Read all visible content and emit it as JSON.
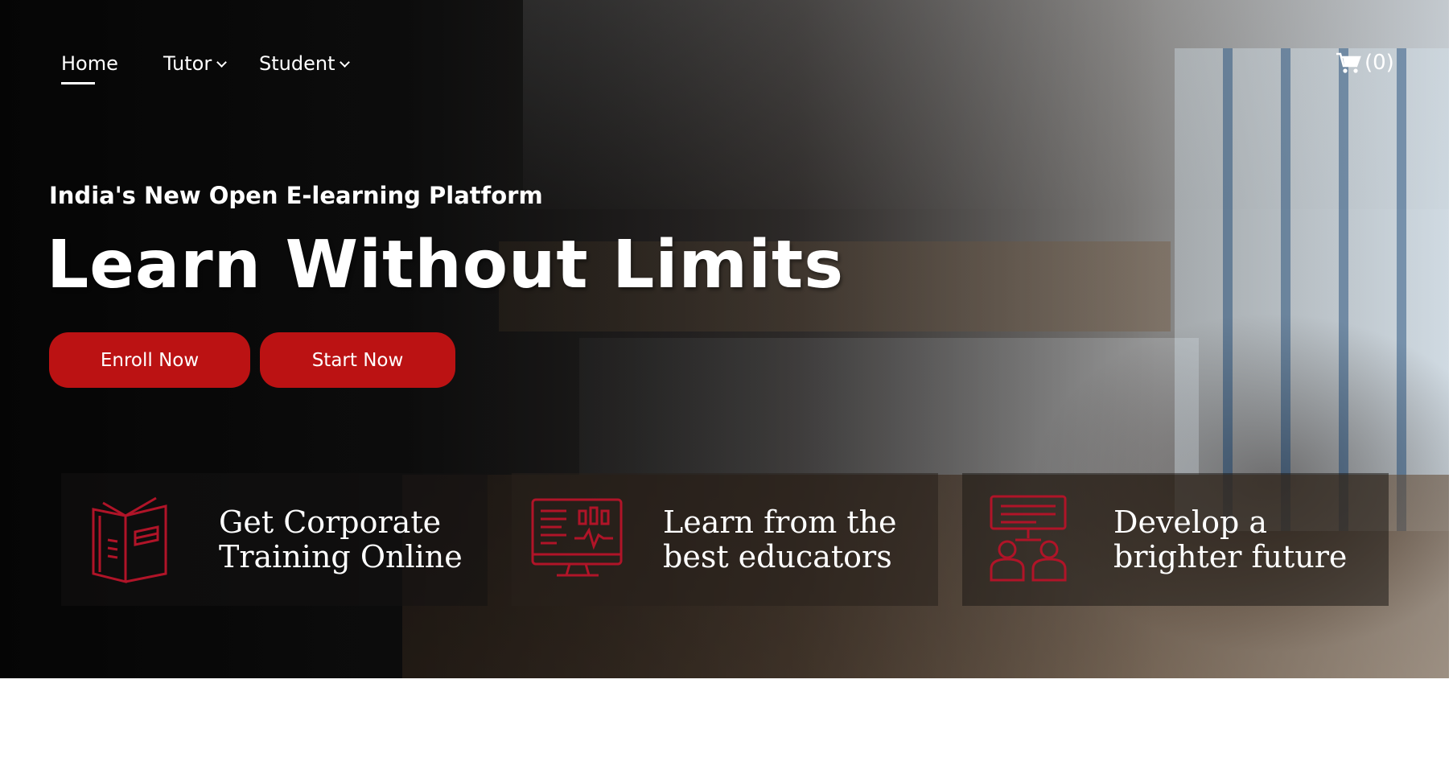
{
  "nav": {
    "home": "Home",
    "tutor": "Tutor",
    "student": "Student",
    "cart_count": "(0)"
  },
  "hero": {
    "tagline": "India's New Open E-learning Platform",
    "headline": "Learn Without Limits",
    "enroll_label": "Enroll Now",
    "start_label": "Start Now"
  },
  "features": [
    {
      "icon": "book-icon",
      "line1": "Get Corporate",
      "line2": "Training Online"
    },
    {
      "icon": "monitor-chart-icon",
      "line1": "Learn from the",
      "line2": "best educators"
    },
    {
      "icon": "presentation-people-icon",
      "line1": "Develop a",
      "line2": "brighter future"
    }
  ],
  "colors": {
    "accent": "#bb1213",
    "icon": "#b01428"
  }
}
